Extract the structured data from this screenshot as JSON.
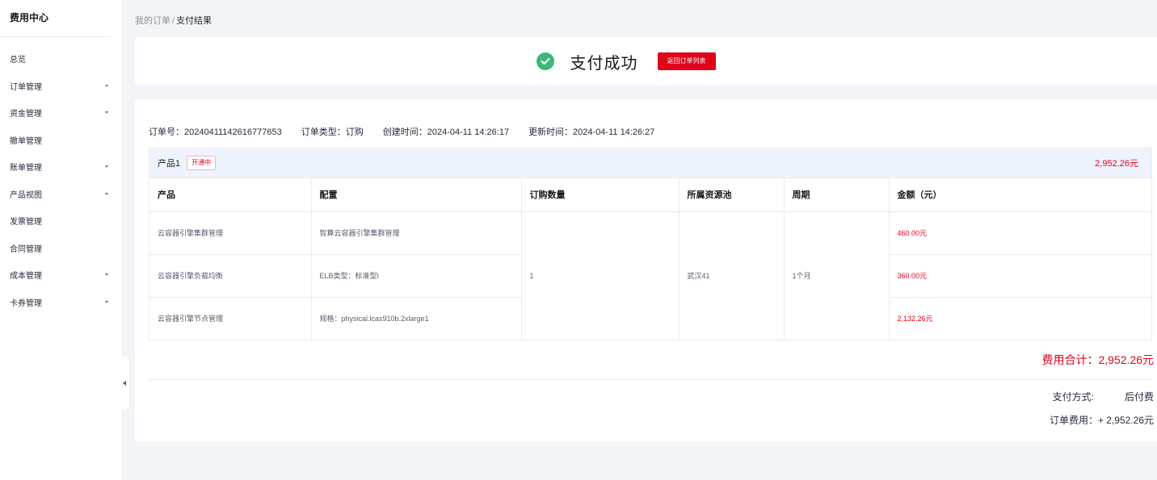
{
  "sidebar": {
    "title": "费用中心",
    "items": [
      {
        "label": "总览",
        "has_caret": false
      },
      {
        "label": "订单管理",
        "has_caret": true
      },
      {
        "label": "资金管理",
        "has_caret": true
      },
      {
        "label": "撤单管理",
        "has_caret": false
      },
      {
        "label": "账单管理",
        "has_caret": true
      },
      {
        "label": "产品视图",
        "has_caret": true
      },
      {
        "label": "发票管理",
        "has_caret": false
      },
      {
        "label": "合同管理",
        "has_caret": false
      },
      {
        "label": "成本管理",
        "has_caret": true
      },
      {
        "label": "卡券管理",
        "has_caret": true
      }
    ]
  },
  "breadcrumb": {
    "parent": "我的订单",
    "separator": "/",
    "current": "支付结果"
  },
  "success": {
    "text": "支付成功",
    "button_label": "返回订单列表",
    "icon": "check-circle-icon",
    "icon_color": "#3cb878"
  },
  "order": {
    "meta": {
      "order_no": "订单号：20240411142616777653",
      "order_type": "订单类型：订购",
      "created": "创建时间：2024-04-11 14:26:17",
      "updated": "更新时间：2024-04-11 14:26:27"
    },
    "product": {
      "name": "产品1",
      "status": "开通中",
      "total": "2,952.26元"
    },
    "columns": [
      "产品",
      "配置",
      "订购数量",
      "所属资源池",
      "周期",
      "金额（元）"
    ],
    "rows": [
      {
        "product": "云容器引擎集群管理",
        "config": "智算云容器引擎集群管理",
        "amount": "460.00元"
      },
      {
        "product": "云容器引擎负载均衡",
        "config": "ELB类型：标准型I",
        "amount": "360.00元"
      },
      {
        "product": "云容器引擎节点管理",
        "config": "规格：physical.lcas910b.2xlarge1",
        "amount": "2,132.26元"
      }
    ],
    "merged": {
      "quantity": "1",
      "pool": "武汉41",
      "period": "1个月"
    },
    "fee_total": "费用合计：2,952.26元",
    "payment_method_label": "支付方式:",
    "payment_method_value": "后付费",
    "order_fee": "订单费用：+ 2,952.26元"
  },
  "colors": {
    "accent_red": "#e1031a",
    "success_green": "#3cb878",
    "product_header_bg": "#eef3fd"
  }
}
